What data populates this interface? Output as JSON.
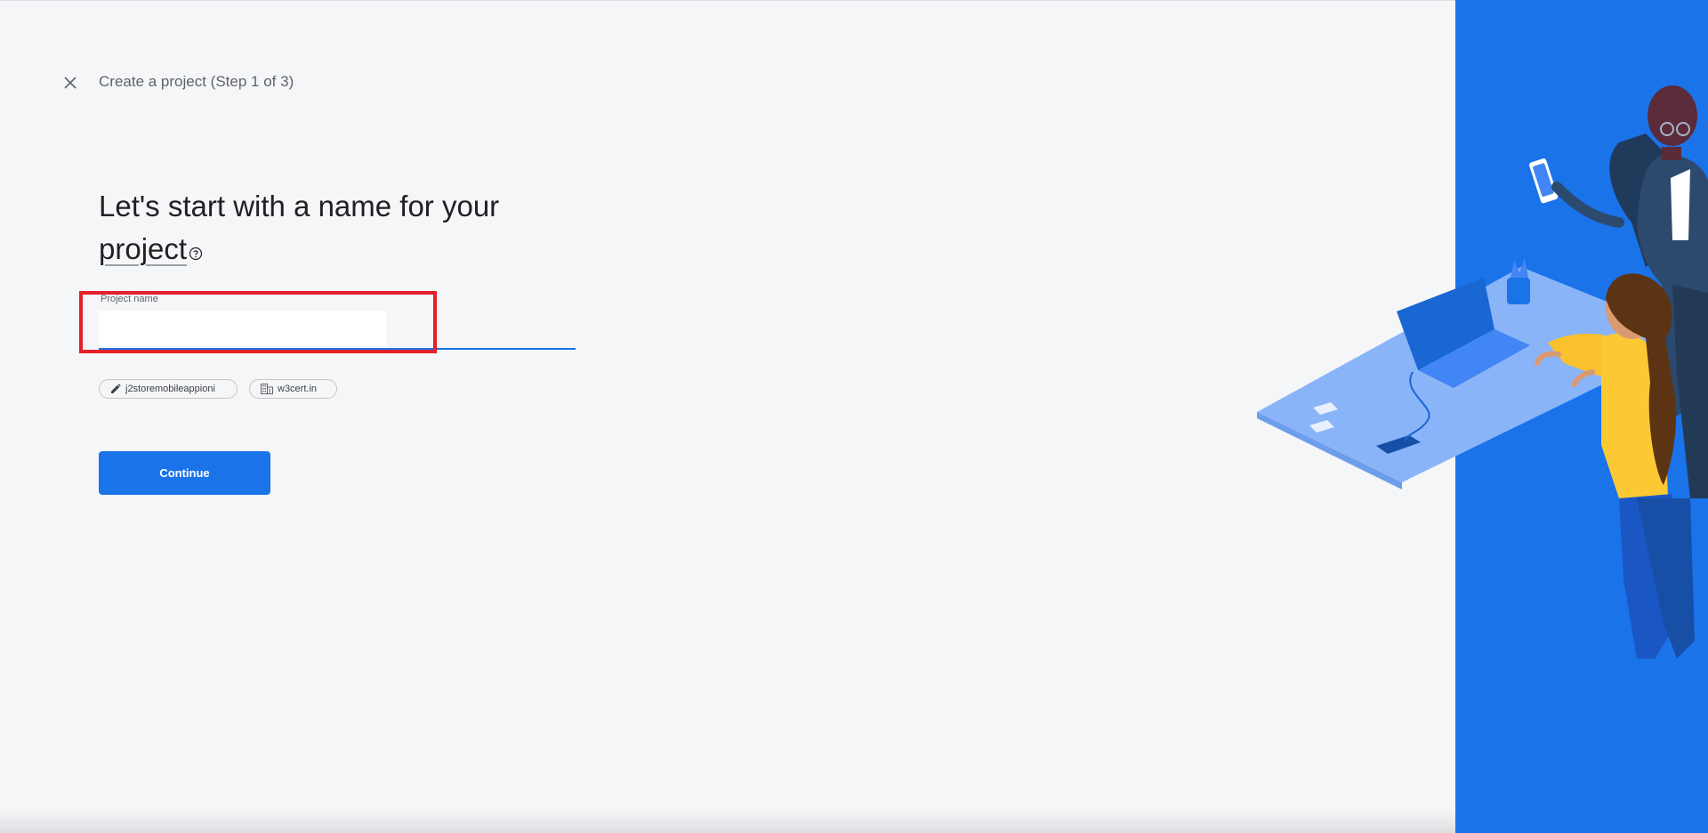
{
  "header": {
    "close_icon": "close-icon",
    "step_title": "Create a project (Step 1 of 3)"
  },
  "main": {
    "heading_part1": "Let's start with a name for your ",
    "heading_keyword": "project",
    "help_icon": "help-circle-icon",
    "field": {
      "label": "Project name",
      "value": "",
      "placeholder": ""
    },
    "chips": [
      {
        "icon": "pencil-icon",
        "label": "j2storemobileappioni"
      },
      {
        "icon": "building-icon",
        "label": "w3cert.in"
      }
    ],
    "continue_label": "Continue"
  },
  "colors": {
    "accent": "#1a73e8",
    "highlight": "#e5202a",
    "background": "#f5f6f8",
    "text_primary": "#202124",
    "text_secondary": "#5f6368"
  }
}
